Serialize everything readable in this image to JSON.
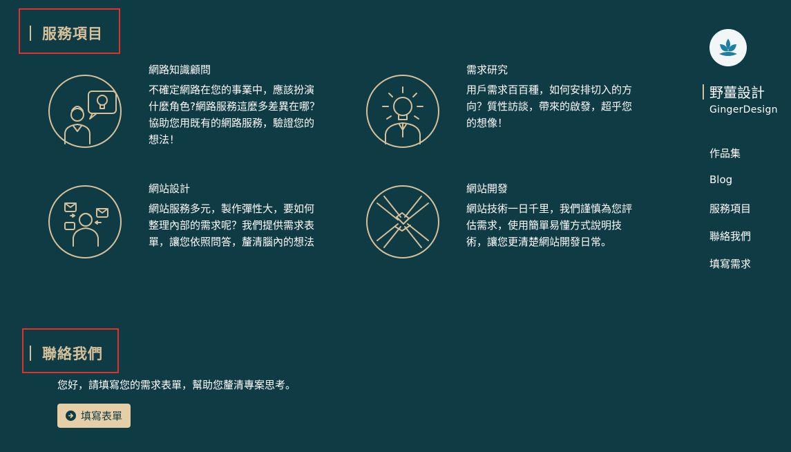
{
  "services_section": {
    "title": "服務項目"
  },
  "services": [
    {
      "title": "網路知識顧問",
      "desc": [
        "不確定網路在您的事業中，應該扮演",
        "什麼角色?網路服務這麼多差異在哪？",
        "協助您用既有的網路服務，驗證您的",
        "想法！"
      ]
    },
    {
      "title": "需求研究",
      "desc": [
        "用戶需求百百種，如何安排切入的方",
        "向？質性訪談，帶來的啟發，超乎您",
        "的想像！"
      ]
    },
    {
      "title": "網站設計",
      "desc": [
        "網站服務多元，製作彈性大，要如何",
        "整理內部的需求呢？我們提供需求表",
        "單，讓您依照問答，釐清腦內的想法"
      ]
    },
    {
      "title": "網站開發",
      "desc": [
        "網站技術一日千里，我們謹慎為您評",
        "估需求，使用簡單易懂方式說明技",
        "術，讓您更清楚網站開發日常。"
      ]
    }
  ],
  "sidebar": {
    "brand_zh": "野薑設計",
    "brand_en": "GingerDesign",
    "nav": [
      "作品集",
      "Blog",
      "服務項目",
      "聯絡我們",
      "填寫需求"
    ]
  },
  "contact_section": {
    "title": "聯絡我們",
    "text": "您好，請填寫您的需求表單，幫助您釐清專案思考。",
    "button_label": "填寫表單"
  },
  "colors": {
    "background": "#0f3b45",
    "accent": "#d6c19a",
    "button": "#e6cfa6",
    "highlight_box": "#e0322a"
  }
}
